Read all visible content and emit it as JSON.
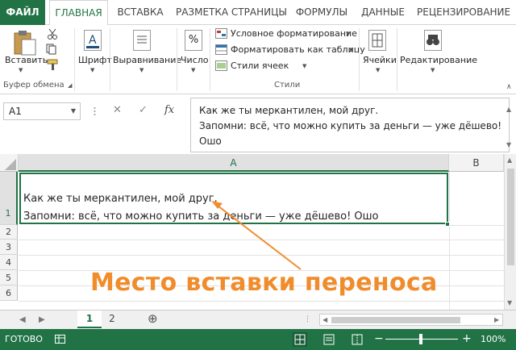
{
  "tabs": [
    {
      "label": "ФАЙЛ"
    },
    {
      "label": "ГЛАВНАЯ"
    },
    {
      "label": "ВСТАВКА"
    },
    {
      "label": "РАЗМЕТКА СТРАНИЦЫ"
    },
    {
      "label": "ФОРМУЛЫ"
    },
    {
      "label": "ДАННЫЕ"
    },
    {
      "label": "РЕЦЕНЗИРОВАНИЕ"
    }
  ],
  "ribbon": {
    "paste_label": "Вставить",
    "clipboard_caption": "Буфер обмена",
    "font_label": "Шрифт",
    "alignment_label": "Выравнивание",
    "number_label": "Число",
    "number_icon_glyph": "%",
    "styles": {
      "conditional": "Условное форматирование",
      "format_table": "Форматировать как таблицу",
      "cell_styles": "Стили ячеек",
      "caption": "Стили"
    },
    "cells_label": "Ячейки",
    "editing_label": "Редактирование"
  },
  "formula_bar": {
    "name_box": "A1",
    "fx_label": "fx",
    "lines": [
      "Как же ты меркантилен, мой друг.",
      "Запомни: всё, что можно купить за деньги — уже дёшево!",
      "Ошо"
    ]
  },
  "grid": {
    "columns": [
      "A",
      "B"
    ],
    "rows": [
      "1",
      "2",
      "3",
      "4",
      "5",
      "6"
    ],
    "cell_a1_lines": [
      "Как же ты меркантилен, мой друг.",
      "Запомни: всё, что можно купить за деньги — уже дёшево! Ошо"
    ]
  },
  "annotation": {
    "text": "Место вставки переноса",
    "color": "#f08c2c"
  },
  "sheets": [
    {
      "label": "1",
      "active": true
    },
    {
      "label": "2",
      "active": false
    }
  ],
  "add_sheet_glyph": "⊕",
  "status": {
    "ready": "ГОТОВО",
    "zoom": "100%",
    "minus": "−",
    "plus": "+"
  },
  "colors": {
    "accent": "#217346"
  }
}
